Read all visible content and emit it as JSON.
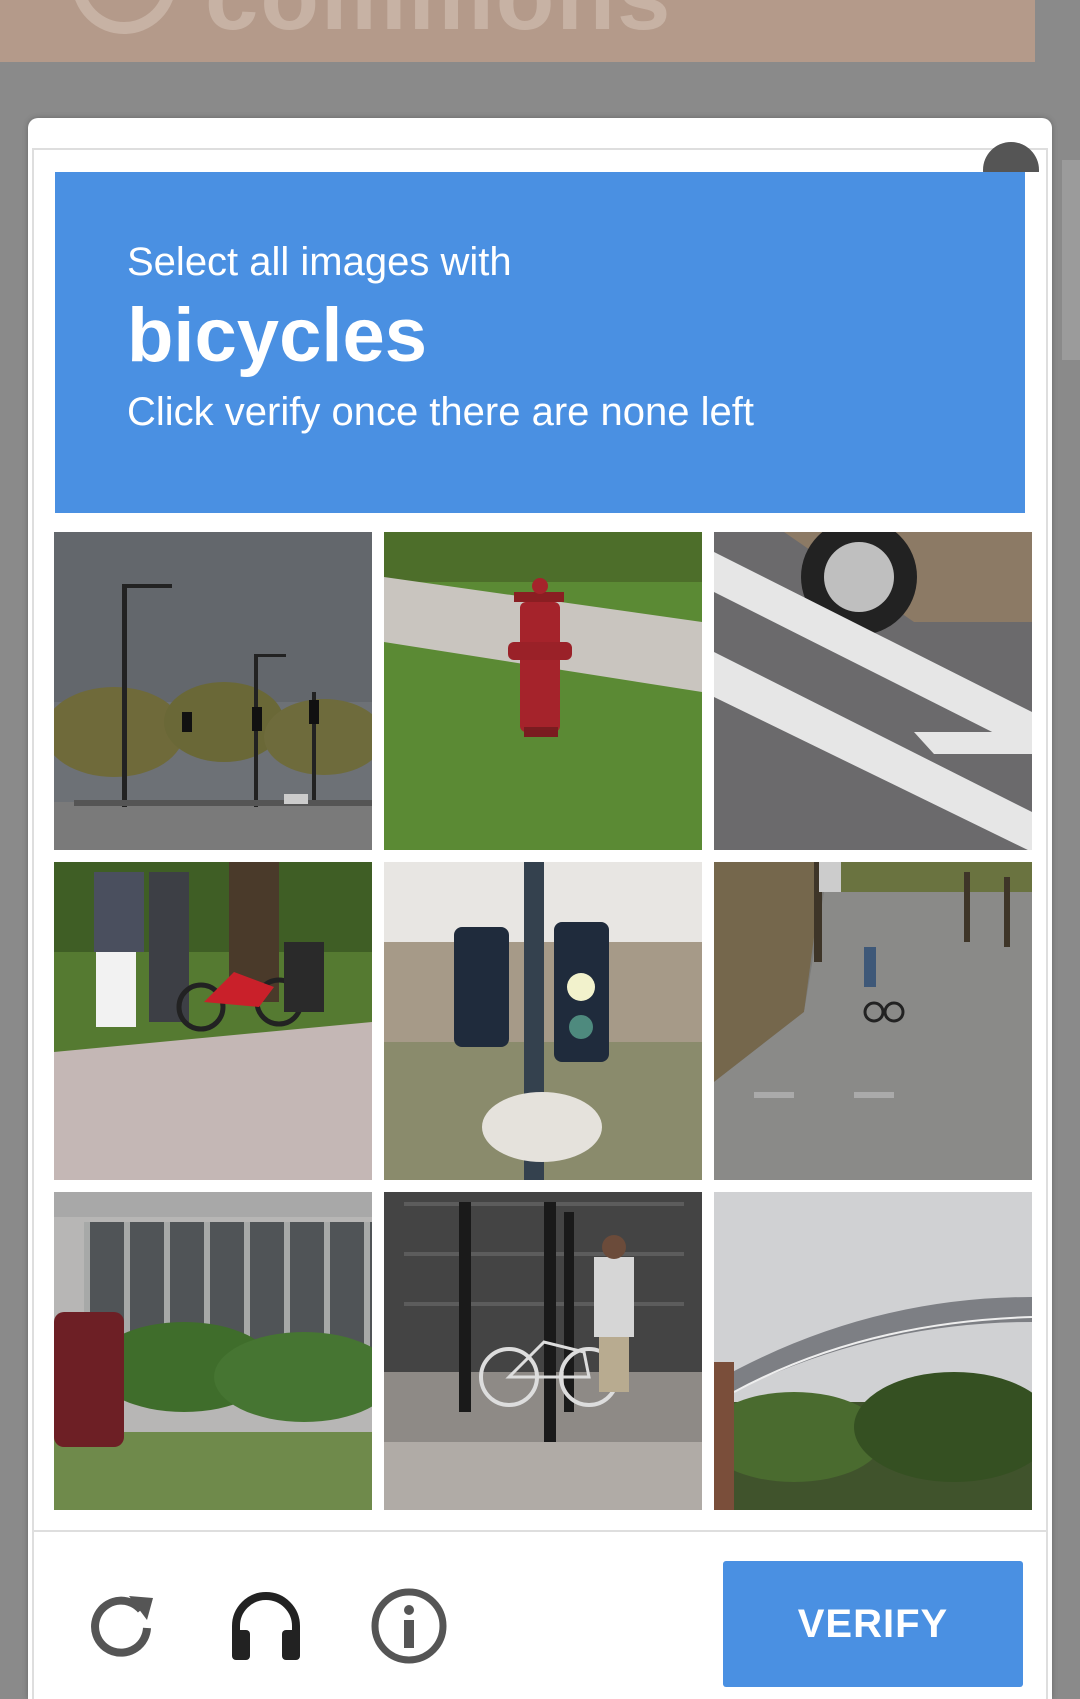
{
  "background": {
    "banner_text": "commons"
  },
  "captcha": {
    "instruction_prefix": "Select all images with",
    "keyword": "bicycles",
    "instruction_suffix": "Click verify once there are none left",
    "tiles": [
      {
        "content": "street lamps and traffic lights"
      },
      {
        "content": "red fire hydrant on grass"
      },
      {
        "content": "car wheel on crosswalk"
      },
      {
        "content": "people with red bicycle"
      },
      {
        "content": "traffic light"
      },
      {
        "content": "child with bicycle on road"
      },
      {
        "content": "building with bushes and car"
      },
      {
        "content": "man with bicycle at post"
      },
      {
        "content": "bridge over trees"
      }
    ],
    "toolbar": {
      "reload_icon": "reload-icon",
      "audio_icon": "headphones-icon",
      "info_icon": "info-icon",
      "verify_label": "VERIFY"
    }
  },
  "colors": {
    "accent": "#4a90e2",
    "overlay": "#7d7d7d"
  }
}
